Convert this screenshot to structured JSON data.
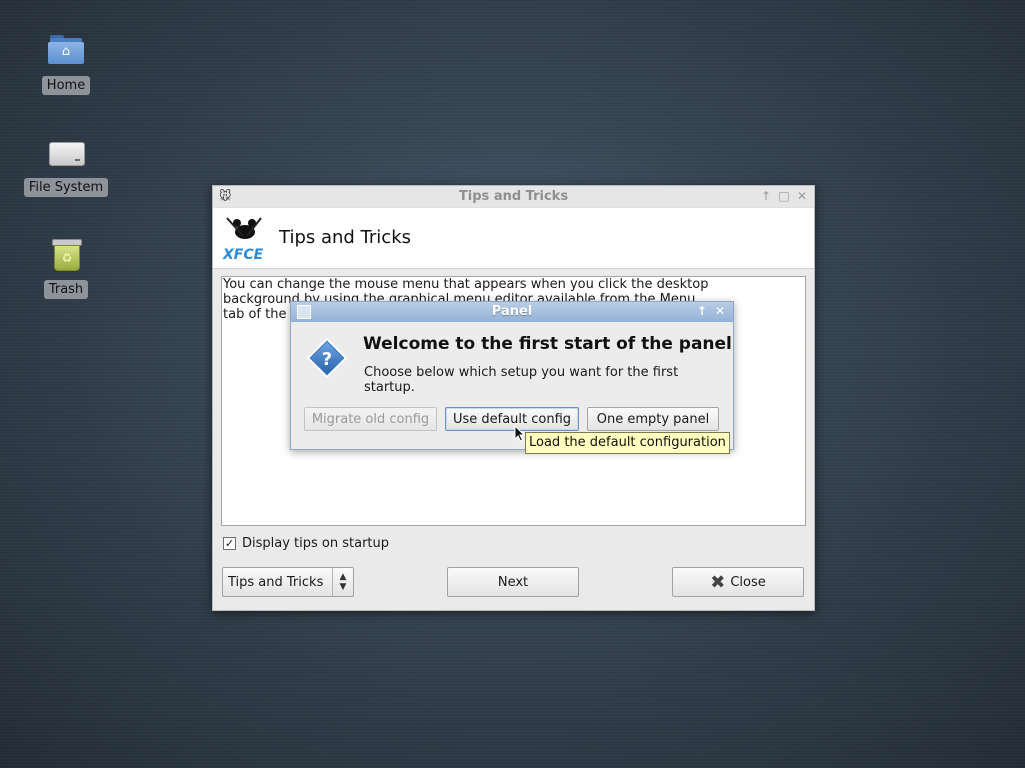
{
  "desktop": {
    "icons": [
      {
        "label": "Home",
        "icon": "home-folder-icon"
      },
      {
        "label": "File System",
        "icon": "drive-icon"
      },
      {
        "label": "Trash",
        "icon": "trash-icon"
      }
    ]
  },
  "tips_window": {
    "title": "Tips and Tricks",
    "heading": "Tips and Tricks",
    "logo_text": "XFCE",
    "tip_lines": [
      "You can change the mouse menu that appears when you click the desktop",
      "background by using the graphical menu  editor available from the Menu",
      "tab of the D"
    ],
    "checkbox_label": "Display tips on startup",
    "checkbox_checked": true,
    "combo_value": "Tips and Tricks",
    "next_label": "Next",
    "close_label": "Close"
  },
  "panel_dialog": {
    "title": "Panel",
    "heading": "Welcome to the first start of the panel",
    "subtext": "Choose below which setup you want for the first startup.",
    "buttons": {
      "migrate": "Migrate old config",
      "default": "Use default config",
      "empty": "One empty panel"
    },
    "tooltip": "Load the default configuration"
  },
  "colors": {
    "dialog_title": "#93b2d6",
    "tooltip_bg": "#ffffbf"
  }
}
